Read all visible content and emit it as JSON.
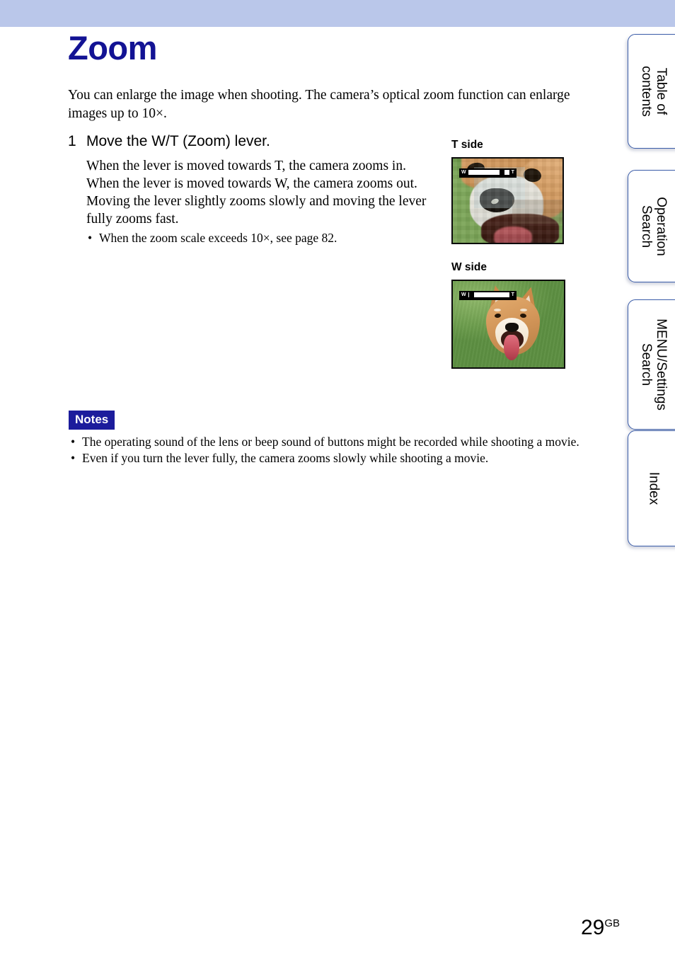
{
  "page": {
    "title": "Zoom",
    "number": "29",
    "number_suffix": "GB",
    "band_color": "#bac7ea",
    "title_color": "#131394"
  },
  "intro": {
    "text": "You can enlarge the image when shooting. The camera’s optical zoom function can enlarge images up to 10×."
  },
  "step": {
    "number": "1",
    "heading": "Move the W/T (Zoom) lever.",
    "lines": [
      "When the lever is moved towards T, the camera zooms in.",
      "When the lever is moved towards W, the camera zooms out.",
      "Moving the lever slightly zooms slowly and moving the lever",
      "fully zooms fast."
    ],
    "bullets": [
      "When the zoom scale exceeds 10×, see page 82."
    ]
  },
  "figures": [
    {
      "label": "T side",
      "caption_alt": "Telephoto close-up of a Shiba Inu dog's face, heavily magnified",
      "zoombar": {
        "w_label": "W",
        "t_label": "T",
        "knob_position_percent": 80
      }
    },
    {
      "label": "W side",
      "caption_alt": "Wide-angle view of a Shiba Inu dog sitting on green grass",
      "zoombar": {
        "w_label": "W",
        "t_label": "T",
        "knob_position_percent": 5
      }
    }
  ],
  "notes": {
    "badge": "Notes",
    "badge_bg": "#1c1c9c",
    "items": [
      "The operating sound of the lens or beep sound of buttons might be recorded while shooting a movie.",
      "Even if you turn the lever fully, the camera zooms slowly while shooting a movie."
    ]
  },
  "tabs": [
    {
      "lines": [
        "Table of",
        "contents"
      ]
    },
    {
      "lines": [
        "Operation",
        "Search"
      ]
    },
    {
      "lines": [
        "MENU/Settings",
        "Search"
      ]
    },
    {
      "lines": [
        "Index"
      ]
    }
  ]
}
